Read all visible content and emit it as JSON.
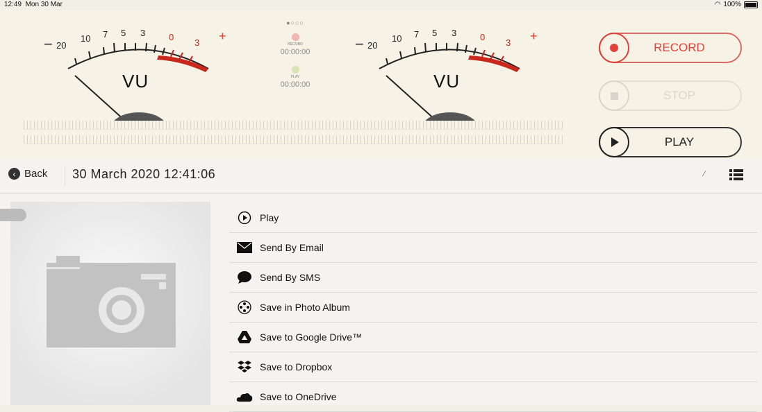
{
  "status": {
    "time": "12:49",
    "date": "Mon 30 Mar",
    "battery": "100%"
  },
  "meter_left": {
    "label": "VU",
    "minus": "−",
    "plus": "+",
    "ticks": [
      "20",
      "10",
      "7",
      "5",
      "3",
      "0",
      "3"
    ]
  },
  "meter_right": {
    "label": "VU",
    "minus": "−",
    "plus": "+",
    "ticks": [
      "20",
      "10",
      "7",
      "5",
      "3",
      "0",
      "3"
    ]
  },
  "indicator": {
    "page_dots": "●○○○",
    "record_label": "RECORD",
    "record_time": "00:00:00",
    "play_label": "PLAY",
    "play_time": "00:00:00"
  },
  "transport": {
    "record": "RECORD",
    "stop": "STOP",
    "play": "PLAY"
  },
  "nav": {
    "back": "Back",
    "title": "30 March 2020 12:41:06"
  },
  "actions": [
    {
      "label": "Play",
      "icon": "play-circle-icon"
    },
    {
      "label": "Send By Email",
      "icon": "envelope-icon"
    },
    {
      "label": "Send By SMS",
      "icon": "speech-bubble-icon"
    },
    {
      "label": "Save in Photo Album",
      "icon": "film-reel-icon"
    },
    {
      "label": "Save to Google Drive™",
      "icon": "google-drive-icon"
    },
    {
      "label": "Save to Dropbox",
      "icon": "dropbox-icon"
    },
    {
      "label": "Save to OneDrive",
      "icon": "onedrive-icon"
    }
  ],
  "colors": {
    "accent": "#e0413a",
    "background": "#f2efe7",
    "disabled": "#d9d5cc"
  }
}
